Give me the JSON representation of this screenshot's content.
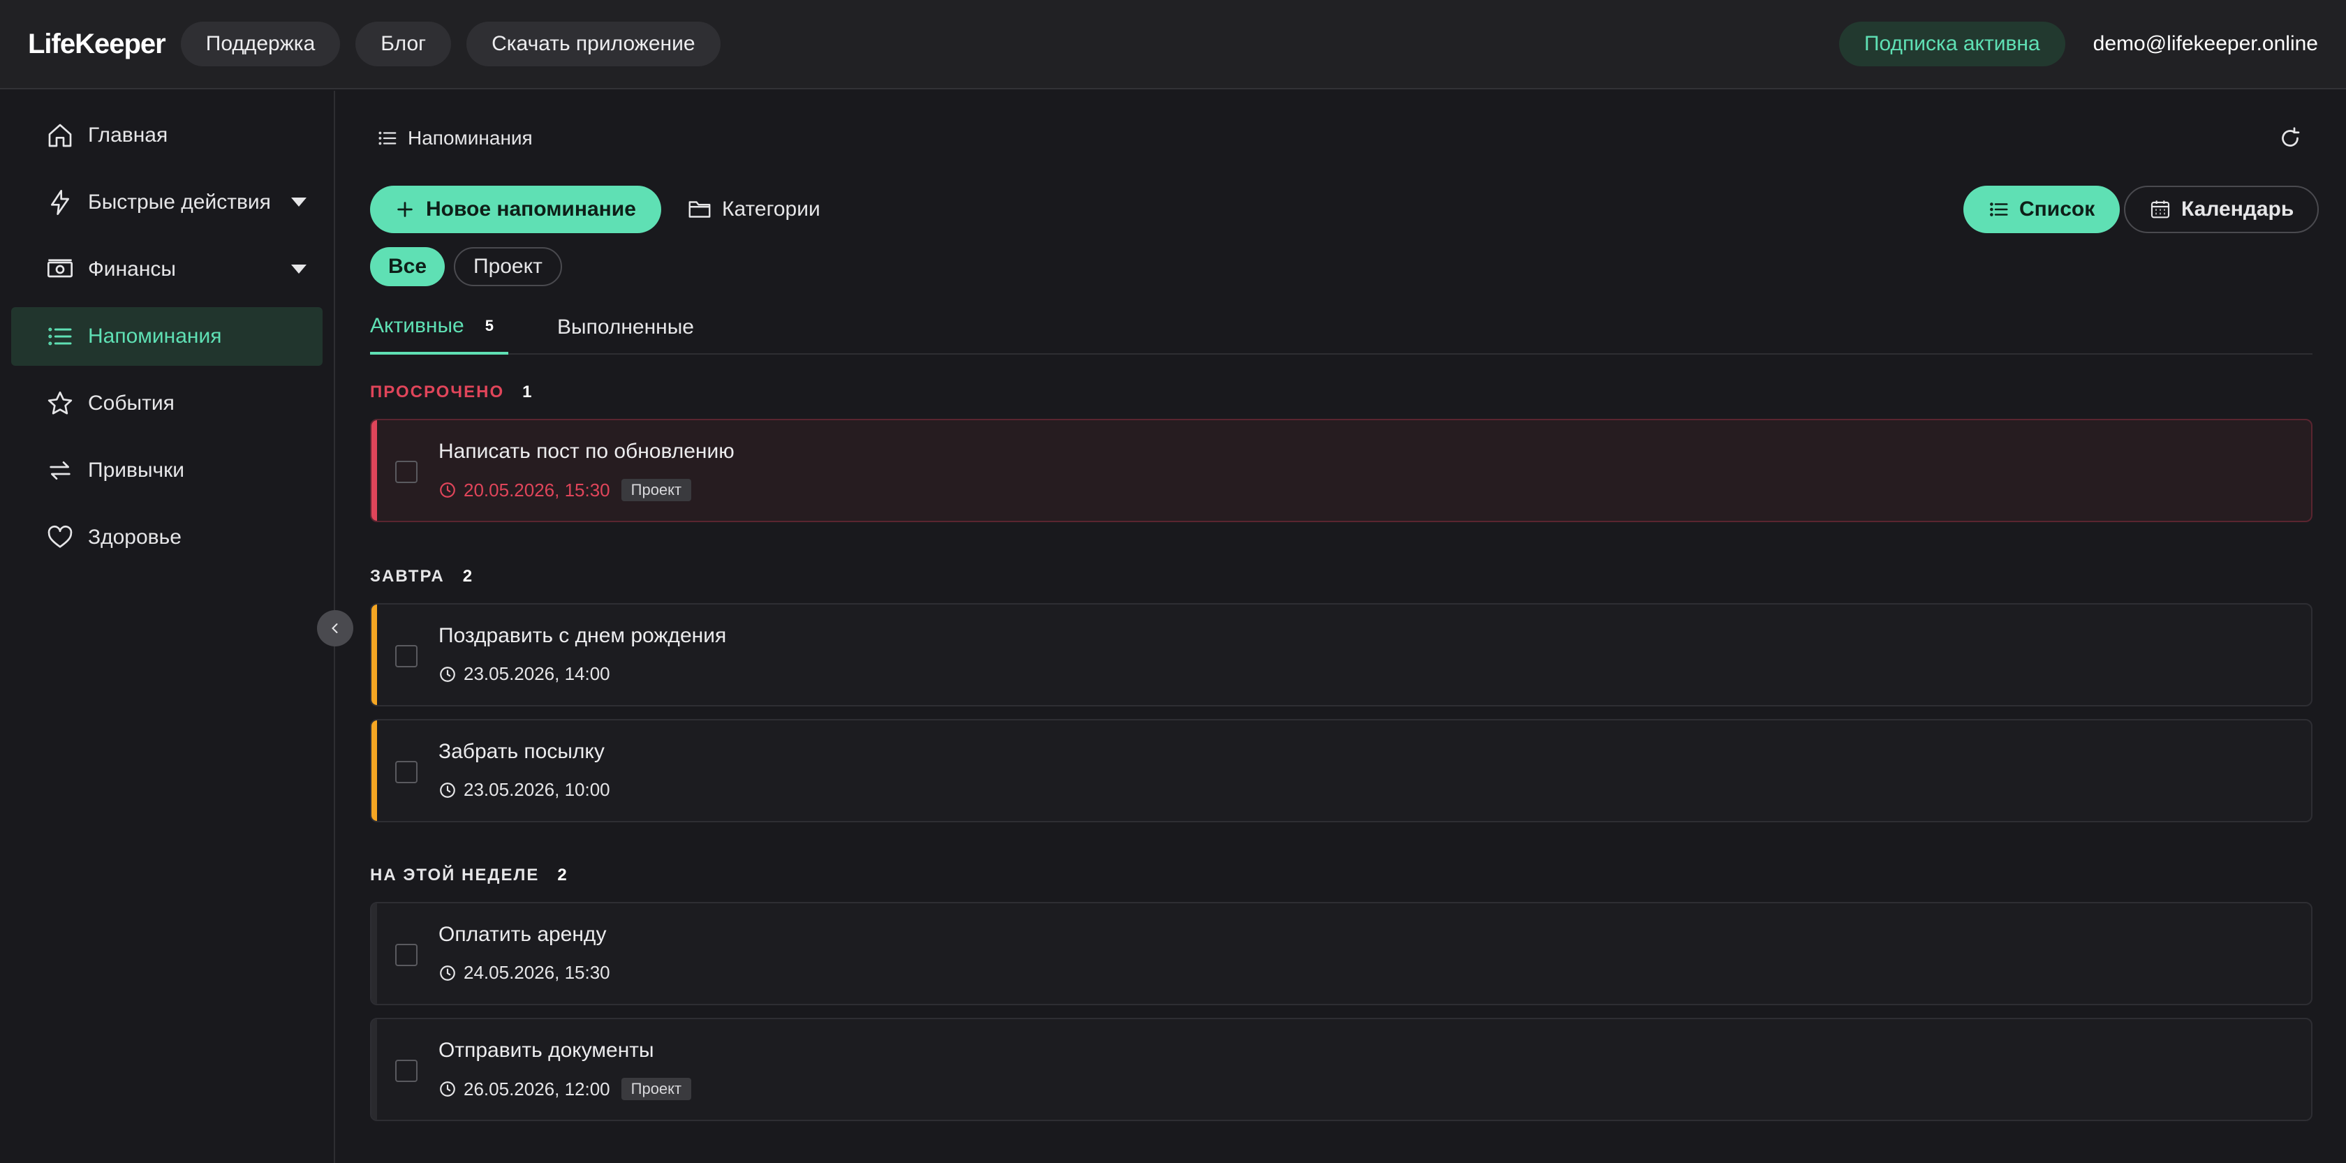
{
  "app": {
    "logo": "LifeKeeper"
  },
  "topbar": {
    "links": [
      "Поддержка",
      "Блог",
      "Скачать приложение"
    ],
    "subscription": "Подписка активна",
    "user_email": "demo@lifekeeper.online"
  },
  "sidebar": {
    "items": [
      {
        "label": "Главная",
        "icon": "home-icon"
      },
      {
        "label": "Быстрые действия",
        "icon": "lightning-icon"
      },
      {
        "label": "Финансы",
        "icon": "money-icon"
      },
      {
        "label": "Напоминания",
        "icon": "list-icon",
        "active": true
      },
      {
        "label": "События",
        "icon": "star-icon"
      },
      {
        "label": "Привычки",
        "icon": "repeat-icon"
      },
      {
        "label": "Здоровье",
        "icon": "heart-icon"
      }
    ]
  },
  "main": {
    "breadcrumb": "Напоминания",
    "new_reminder": "Новое напоминание",
    "categories": "Категории",
    "view_list": "Список",
    "view_calendar": "Календарь",
    "filters": [
      "Все",
      "Проект"
    ],
    "tabs": {
      "active": "Активные",
      "active_count": "5",
      "done": "Выполненные"
    },
    "sections": [
      {
        "title": "ПРОСРОЧЕНО",
        "count": "1",
        "items": [
          {
            "title": "Написать пост по обновлению",
            "date": "20.05.2026, 15:30",
            "tag": "Проект"
          }
        ]
      },
      {
        "title": "ЗАВТРА",
        "count": "2",
        "items": [
          {
            "title": "Поздравить с днем рождения",
            "date": "23.05.2026, 14:00"
          },
          {
            "title": "Забрать посылку",
            "date": "23.05.2026, 10:00"
          }
        ]
      },
      {
        "title": "НА ЭТОЙ НЕДЕЛЕ",
        "count": "2",
        "items": [
          {
            "title": "Оплатить аренду",
            "date": "24.05.2026, 15:30"
          },
          {
            "title": "Отправить документы",
            "date": "26.05.2026, 12:00",
            "tag": "Проект"
          }
        ]
      }
    ]
  },
  "colors": {
    "accent": "#5fe0b4",
    "overdue": "#e0455a",
    "soon": "#f5a623",
    "bg": "#19191d"
  }
}
